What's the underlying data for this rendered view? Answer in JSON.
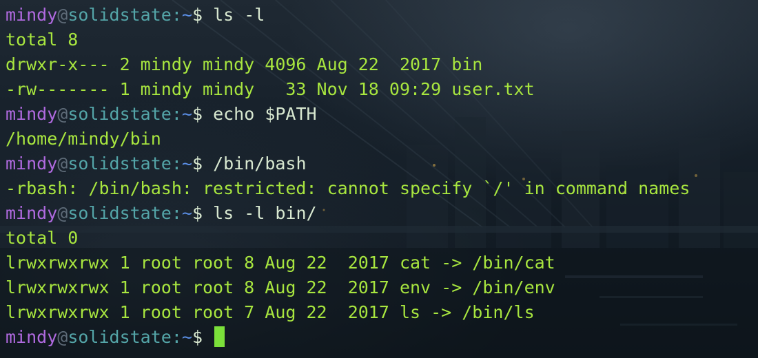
{
  "theme": {
    "prompt_user_color": "#b06ae0",
    "prompt_host_color": "#54a5a8",
    "prompt_path_color": "#5b8fe6",
    "output_color": "#a8e63f",
    "command_color": "#d8e8d0",
    "cursor_color": "#7be03a"
  },
  "prompt": {
    "user": "mindy",
    "at": "@",
    "host": "solidstate",
    "sep": ":",
    "path": "~",
    "symbol": "$ "
  },
  "lines": [
    {
      "type": "prompt",
      "command": "ls -l"
    },
    {
      "type": "output",
      "text": "total 8"
    },
    {
      "type": "output",
      "text": "drwxr-x--- 2 mindy mindy 4096 Aug 22  2017 bin"
    },
    {
      "type": "output",
      "text": "-rw------- 1 mindy mindy   33 Nov 18 09:29 user.txt"
    },
    {
      "type": "prompt",
      "command": "echo $PATH"
    },
    {
      "type": "output",
      "text": "/home/mindy/bin"
    },
    {
      "type": "prompt",
      "command": "/bin/bash"
    },
    {
      "type": "output",
      "text": "-rbash: /bin/bash: restricted: cannot specify `/' in command names"
    },
    {
      "type": "prompt",
      "command": "ls -l bin/"
    },
    {
      "type": "output",
      "text": "total 0"
    },
    {
      "type": "output",
      "text": "lrwxrwxrwx 1 root root 8 Aug 22  2017 cat -> /bin/cat"
    },
    {
      "type": "output",
      "text": "lrwxrwxrwx 1 root root 8 Aug 22  2017 env -> /bin/env"
    },
    {
      "type": "output",
      "text": "lrwxrwxrwx 1 root root 7 Aug 22  2017 ls -> /bin/ls"
    },
    {
      "type": "prompt",
      "command": "",
      "cursor": true
    }
  ]
}
